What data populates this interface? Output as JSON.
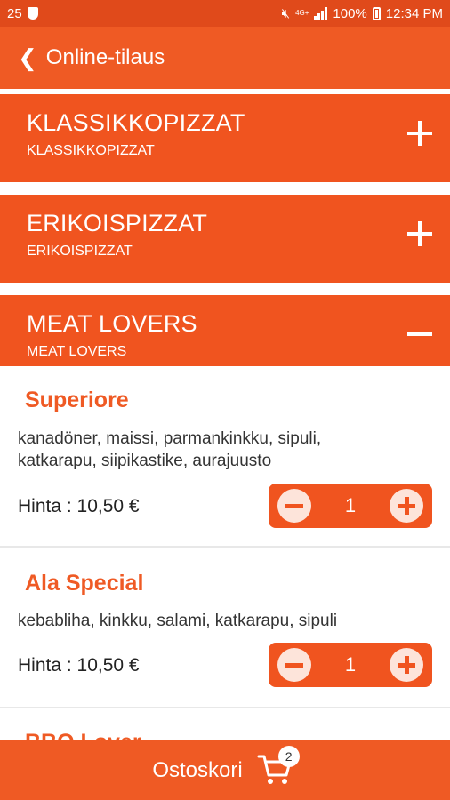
{
  "status_bar": {
    "notification_count": "25",
    "network_label": "4G+",
    "battery_percent": "100%",
    "time": "12:34 PM"
  },
  "app_bar": {
    "title": "Online-tilaus",
    "back_icon": "chevron-left-icon"
  },
  "categories": [
    {
      "title": "KLASSIKKOPIZZAT",
      "subtitle": "KLASSIKKOPIZZAT",
      "expanded": false
    },
    {
      "title": "ERIKOISPIZZAT",
      "subtitle": "ERIKOISPIZZAT",
      "expanded": false
    },
    {
      "title": "MEAT LOVERS",
      "subtitle": "MEAT LOVERS",
      "expanded": true
    }
  ],
  "products": [
    {
      "name": "Superiore",
      "description": "kanadöner, maissi, parmankinkku, sipuli, katkarapu, siipikastike, aurajuusto",
      "price": "Hinta : 10,50 €",
      "quantity": "1"
    },
    {
      "name": "Ala Special",
      "description": "kebabliha, kinkku, salami, katkarapu, sipuli",
      "price": "Hinta : 10,50 €",
      "quantity": "1"
    },
    {
      "name": "BBQ Lover"
    }
  ],
  "bottom_bar": {
    "label": "Ostoskori",
    "cart_count": "2"
  },
  "colors": {
    "accent": "#ef5a24",
    "category_bg": "#f0541f",
    "status_bar": "#e04a1b"
  }
}
